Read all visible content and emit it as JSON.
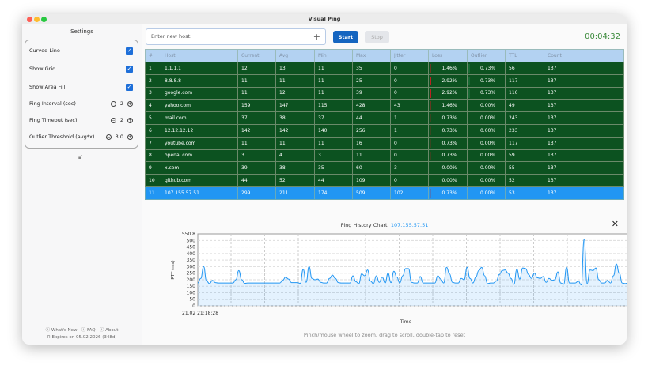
{
  "window": {
    "title": "Visual Ping"
  },
  "sidebar": {
    "title": "Settings",
    "checks": [
      {
        "label": "Curved Line",
        "checked": true
      },
      {
        "label": "Show Grid",
        "checked": true
      },
      {
        "label": "Show Area Fill",
        "checked": true
      }
    ],
    "steppers": [
      {
        "label": "Ping Interval  (sec)",
        "value": "2"
      },
      {
        "label": "Ping Timeout (sec)",
        "value": "2"
      },
      {
        "label": "Outlier Threshold  (avg*x)",
        "value": "3.0"
      }
    ],
    "links": [
      "What's New",
      "FAQ",
      "About"
    ],
    "expires": "Expires on 05.02.2026 (348d)"
  },
  "toolbar": {
    "host_placeholder": "Enter new host:",
    "start": "Start",
    "stop": "Stop",
    "timer": "00:04:32"
  },
  "table": {
    "columns": [
      "#",
      "Host",
      "Current",
      "Avg",
      "Min",
      "Max",
      "Jitter",
      "Loss",
      "Outlier",
      "TTL",
      "Count",
      ""
    ],
    "rows": [
      [
        "1",
        "1.1.1.1",
        "12",
        "13",
        "11",
        "35",
        "0",
        "1.46%",
        "0.73%",
        "56",
        "137"
      ],
      [
        "2",
        "8.8.8.8",
        "11",
        "11",
        "11",
        "25",
        "0",
        "2.92%",
        "0.73%",
        "117",
        "137"
      ],
      [
        "3",
        "google.com",
        "11",
        "12",
        "11",
        "39",
        "0",
        "2.92%",
        "0.73%",
        "116",
        "137"
      ],
      [
        "4",
        "yahoo.com",
        "159",
        "147",
        "115",
        "428",
        "43",
        "1.46%",
        "0.00%",
        "49",
        "137"
      ],
      [
        "5",
        "mail.com",
        "37",
        "38",
        "37",
        "44",
        "1",
        "0.73%",
        "0.00%",
        "243",
        "137"
      ],
      [
        "6",
        "12.12.12.12",
        "142",
        "142",
        "140",
        "256",
        "1",
        "0.73%",
        "0.00%",
        "233",
        "137"
      ],
      [
        "7",
        "youtube.com",
        "11",
        "11",
        "11",
        "16",
        "0",
        "0.73%",
        "0.00%",
        "117",
        "137"
      ],
      [
        "8",
        "openai.com",
        "3",
        "4",
        "3",
        "11",
        "0",
        "0.73%",
        "0.00%",
        "59",
        "137"
      ],
      [
        "9",
        "x.com",
        "39",
        "38",
        "35",
        "60",
        "3",
        "0.00%",
        "0.00%",
        "55",
        "137"
      ],
      [
        "10",
        "github.com",
        "44",
        "52",
        "44",
        "109",
        "0",
        "0.00%",
        "0.00%",
        "52",
        "137"
      ],
      [
        "11",
        "107.155.57.51",
        "299",
        "211",
        "174",
        "509",
        "102",
        "0.73%",
        "0.00%",
        "53",
        "137"
      ]
    ],
    "selected_row": 10
  },
  "chart": {
    "title_prefix": "Ping History Chart: ",
    "host": "107.155.57.51",
    "close": "✕",
    "hint": "Pinch/mouse wheel to zoom, drag to scroll, double-tap to reset"
  },
  "chart_data": {
    "type": "area",
    "ylabel": "RTT (ms)",
    "xlabel": "Time",
    "x_start_label": "21.02 21:18:28",
    "ylim": [
      0,
      550.8
    ],
    "ymax_label": "550.8",
    "yticks": [
      0,
      50,
      100,
      150,
      200,
      250,
      300,
      350,
      400,
      450,
      500
    ],
    "grid": true,
    "line_color": "#2196f3",
    "values": [
      175,
      210,
      300,
      190,
      170,
      195,
      178,
      175,
      175,
      175,
      175,
      175,
      175,
      200,
      270,
      200,
      172,
      175,
      175,
      175,
      175,
      175,
      175,
      175,
      175,
      175,
      175,
      175,
      175,
      195,
      220,
      205,
      178,
      178,
      178,
      172,
      280,
      180,
      300,
      210,
      200,
      205,
      180,
      175,
      175,
      210,
      235,
      210,
      178,
      175,
      175,
      175,
      175,
      230,
      185,
      170,
      245,
      230,
      275,
      190,
      170,
      230,
      180,
      220,
      175,
      250,
      178,
      265,
      220,
      175,
      230,
      285,
      285,
      180,
      175,
      175,
      225,
      175,
      175,
      175,
      175,
      175,
      230,
      205,
      175,
      295,
      245,
      180,
      175,
      175,
      210,
      200,
      295,
      210,
      175,
      220,
      270,
      295,
      230,
      170,
      175,
      175,
      190,
      240,
      270,
      275,
      250,
      210,
      165,
      280,
      205,
      290,
      285,
      240,
      210,
      250,
      215,
      210,
      225,
      180,
      210,
      195,
      200,
      260,
      175,
      165,
      295,
      175,
      175,
      175,
      190,
      160,
      510,
      170,
      275,
      270,
      290,
      200,
      175,
      175,
      195,
      175,
      230,
      320,
      250,
      175,
      170,
      175,
      175,
      175,
      175,
      260,
      175,
      180
    ]
  }
}
